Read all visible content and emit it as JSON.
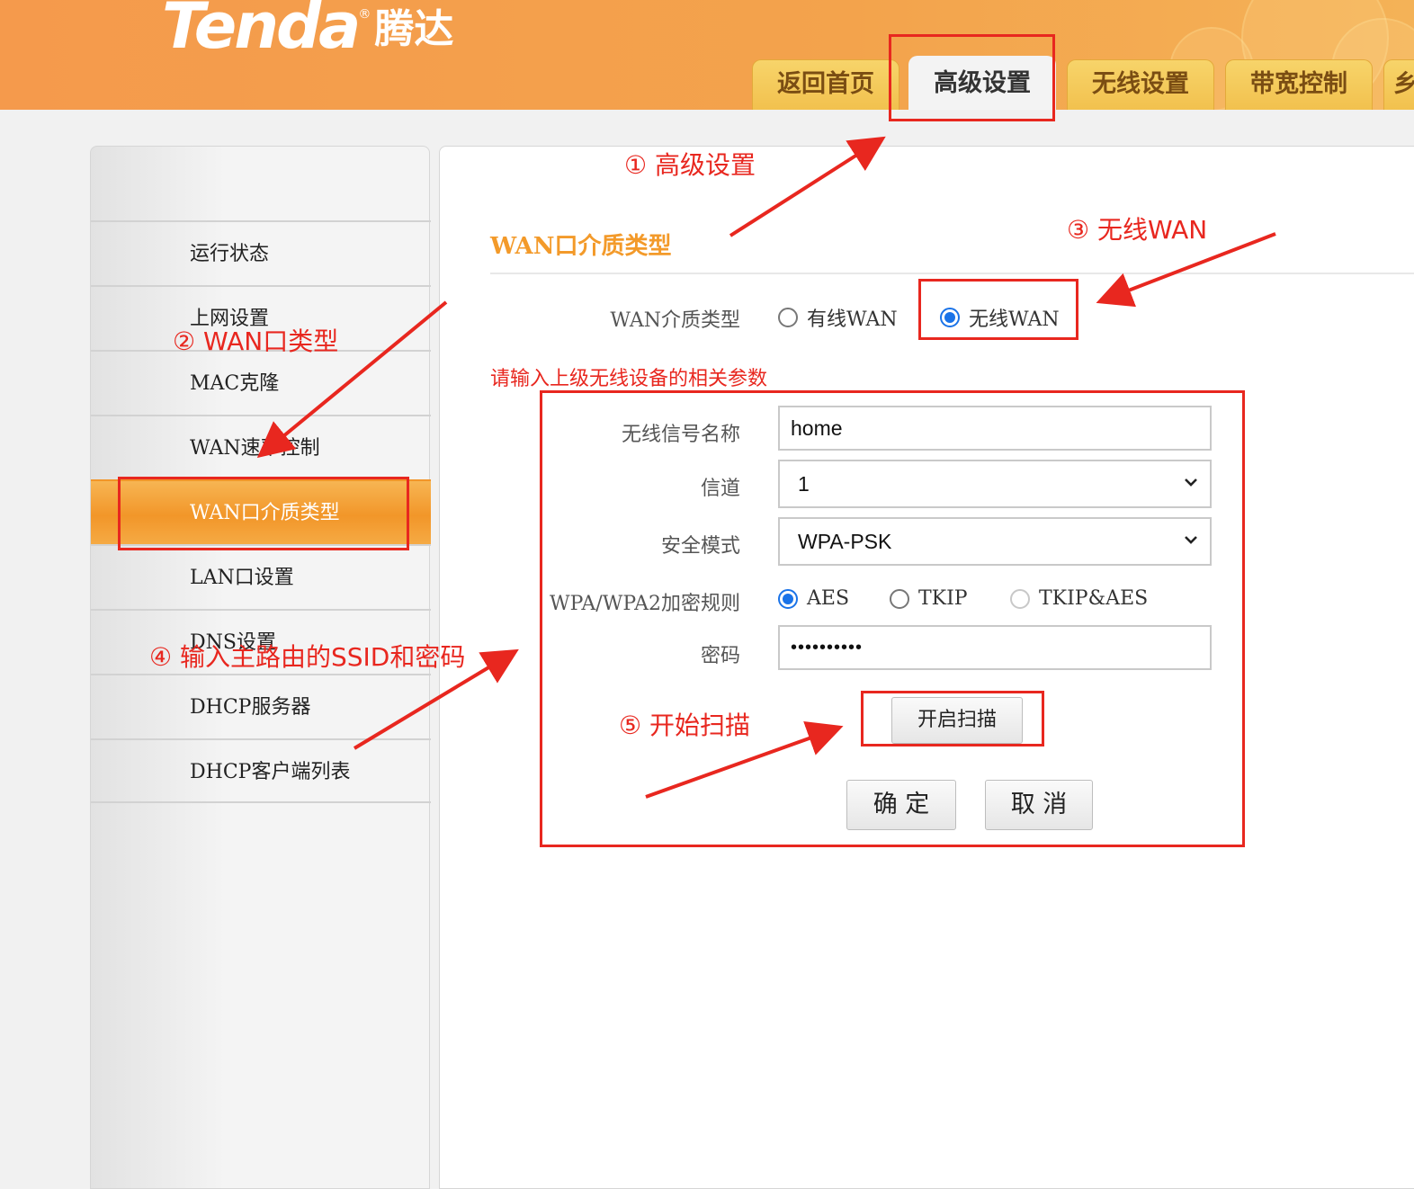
{
  "header": {
    "logo_en": "Tenda",
    "logo_reg": "®",
    "logo_cn": "腾达",
    "tabs": [
      "返回首页",
      "高级设置",
      "无线设置",
      "带宽控制",
      "乡"
    ],
    "active_tab": "高级设置"
  },
  "sidebar": {
    "items": [
      "运行状态",
      "上网设置",
      "MAC克隆",
      "WAN速率控制",
      "WAN口介质类型",
      "LAN口设置",
      "DNS设置",
      "DHCP服务器",
      "DHCP客户端列表"
    ],
    "active_item": "WAN口介质类型"
  },
  "main": {
    "section_title": "WAN口介质类型",
    "wan_type": {
      "label": "WAN介质类型",
      "options": [
        "有线WAN",
        "无线WAN"
      ],
      "selected": "无线WAN"
    },
    "hint": "请输入上级无线设备的相关参数",
    "ssid": {
      "label": "无线信号名称",
      "value": "home"
    },
    "channel": {
      "label": "信道",
      "value": "1"
    },
    "security_mode": {
      "label": "安全模式",
      "value": "WPA-PSK"
    },
    "cipher": {
      "label": "WPA/WPA2加密规则",
      "options": [
        "AES",
        "TKIP",
        "TKIP&AES"
      ],
      "selected": "AES"
    },
    "password": {
      "label": "密码",
      "value": "••••••••••"
    },
    "scan_button": "开启扫描",
    "ok_button": "确 定",
    "cancel_button": "取 消"
  },
  "annotations": {
    "step1": "① 高级设置",
    "step2": "② WAN口类型",
    "step3": "③ 无线WAN",
    "step4": "④ 输入主路由的SSID和密码",
    "step5": "⑤ 开始扫描"
  },
  "colors": {
    "header_orange": "#f59a4c",
    "tab_yellow": "#f2c14e",
    "accent_orange": "#f39a2a",
    "annotation_red": "#e8271f",
    "radio_blue": "#1a73e8"
  }
}
